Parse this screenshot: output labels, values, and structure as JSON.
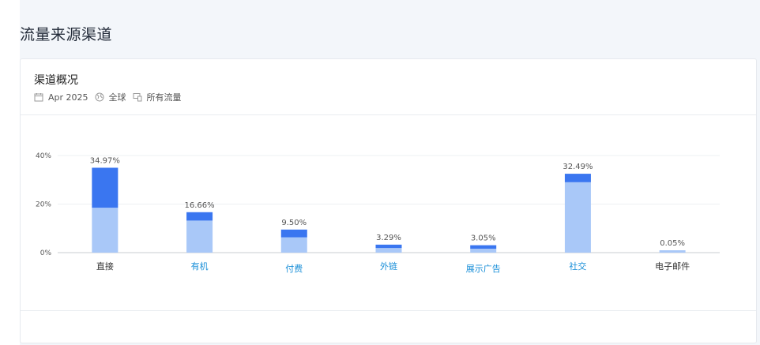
{
  "page": {
    "title": "流量来源渠道"
  },
  "card": {
    "title": "渠道概况",
    "meta": {
      "date": "Apr 2025",
      "region": "全球",
      "traffic": "所有流量"
    }
  },
  "colors": {
    "dark_bar": "#3a76f0",
    "light_bar": "#a9c8f8",
    "link": "#1a8fd8",
    "plain": "#333333"
  },
  "chart_data": {
    "type": "bar",
    "stacked": true,
    "categories": [
      "直接",
      "有机",
      "付费",
      "外链",
      "展示广告",
      "社交",
      "电子邮件"
    ],
    "category_is_link": [
      false,
      true,
      true,
      true,
      true,
      true,
      false
    ],
    "totals": [
      34.97,
      16.66,
      9.5,
      3.29,
      3.05,
      32.49,
      0.05
    ],
    "total_labels": [
      "34.97%",
      "16.66%",
      "9.50%",
      "3.29%",
      "3.05%",
      "32.49%",
      "0.05%"
    ],
    "series": [
      {
        "values": [
          18.5,
          13.2,
          6.3,
          1.9,
          1.6,
          29.0,
          0.05
        ]
      },
      {
        "values": [
          16.47,
          3.46,
          3.2,
          1.39,
          1.45,
          3.49,
          0.0
        ]
      }
    ],
    "y_ticks": [
      "0%",
      "20%",
      "40%"
    ],
    "y_tick_values": [
      0,
      20,
      40
    ],
    "ylim": [
      0,
      40
    ],
    "grid": true
  }
}
